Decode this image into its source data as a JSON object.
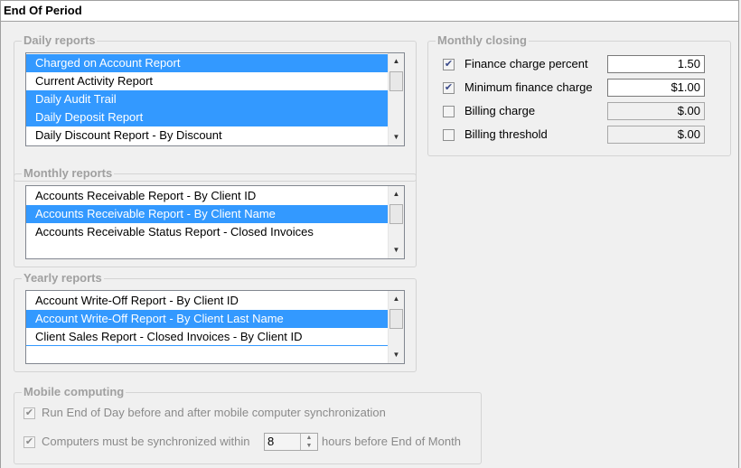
{
  "window": {
    "title": "End Of Period"
  },
  "daily_reports": {
    "legend": "Daily reports",
    "items": [
      {
        "label": "Charged on Account Report",
        "selected": true
      },
      {
        "label": "Current Activity Report",
        "selected": false
      },
      {
        "label": "Daily Audit Trail",
        "selected": true
      },
      {
        "label": "Daily Deposit Report",
        "selected": true
      },
      {
        "label": "Daily Discount Report - By Discount",
        "selected": false
      }
    ]
  },
  "monthly_reports": {
    "legend": "Monthly reports",
    "items": [
      {
        "label": "Accounts Receivable Report - By Client ID",
        "selected": false
      },
      {
        "label": "Accounts Receivable Report - By Client Name",
        "selected": true
      },
      {
        "label": "Accounts Receivable Status Report - Closed Invoices",
        "selected": false
      }
    ]
  },
  "yearly_reports": {
    "legend": "Yearly reports",
    "items": [
      {
        "label": "Account Write-Off Report - By Client ID",
        "selected": false
      },
      {
        "label": "Account Write-Off Report - By Client Last Name",
        "selected": true
      },
      {
        "label": "Client Sales Report - Closed Invoices - By Client ID",
        "selected": false
      }
    ]
  },
  "monthly_closing": {
    "legend": "Monthly closing",
    "finance_charge_percent": {
      "label": "Finance charge percent",
      "checked": true,
      "value": "1.50"
    },
    "minimum_finance_charge": {
      "label": "Minimum finance charge",
      "checked": true,
      "value": "$1.00"
    },
    "billing_charge": {
      "label": "Billing charge",
      "checked": false,
      "value": "$.00"
    },
    "billing_threshold": {
      "label": "Billing threshold",
      "checked": false,
      "value": "$.00"
    }
  },
  "mobile_computing": {
    "legend": "Mobile computing",
    "run_eod": {
      "label": "Run End of Day before and after mobile computer synchronization",
      "checked": true
    },
    "sync_within": {
      "label_before": "Computers must be synchronized within",
      "value": "8",
      "label_after": "hours before End of Month",
      "checked": true
    }
  },
  "colors": {
    "selection": "#3399ff",
    "disabled_text": "#8a8a8a",
    "group_border": "#d4d4d4"
  }
}
